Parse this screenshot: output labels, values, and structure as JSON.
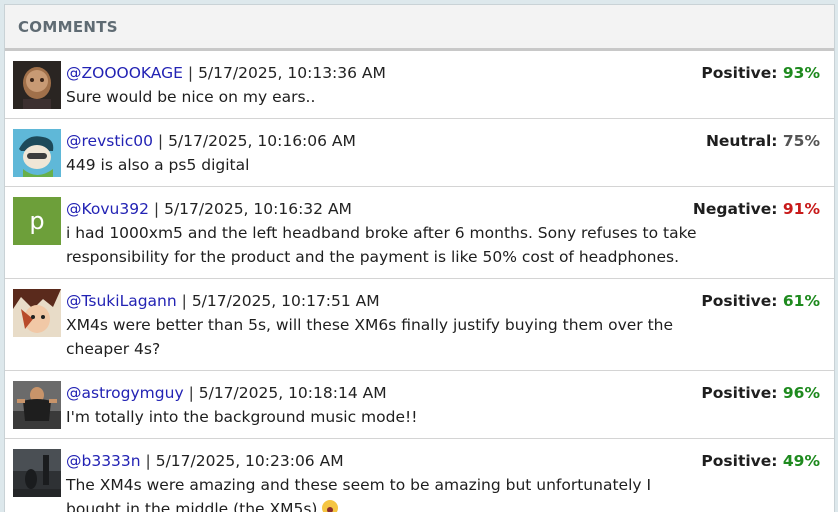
{
  "header": {
    "title": "COMMENTS"
  },
  "colors": {
    "positive": "#1e8a1e",
    "neutral": "#555555",
    "negative": "#c81a1a",
    "user": "#2323b4"
  },
  "comments": [
    {
      "user": "@ZOOOOKAGE",
      "separator": "|",
      "timestamp": "5/17/2025, 10:13:36 AM",
      "text": "Sure would be nice on my ears..",
      "sentiment_label": "Positive:",
      "sentiment_score": "93%",
      "sentiment": "positive",
      "avatar": "photo-avatar"
    },
    {
      "user": "@revstic00",
      "separator": "|",
      "timestamp": "5/17/2025, 10:16:06 AM",
      "text": "449 is also a ps5 digital",
      "sentiment_label": "Neutral:",
      "sentiment_score": "75%",
      "sentiment": "neutral",
      "avatar": "cartoon-avatar"
    },
    {
      "user": "@Kovu392",
      "separator": "|",
      "timestamp": "5/17/2025, 10:16:32 AM",
      "text": "i had 1000xm5 and the left headband broke after 6 months. Sony refuses to take responsibility for the product and the payment is like 50% cost of headphones.",
      "sentiment_label": "Negative:",
      "sentiment_score": "91%",
      "sentiment": "negative",
      "avatar_letter": "p"
    },
    {
      "user": "@TsukiLagann",
      "separator": "|",
      "timestamp": "5/17/2025, 10:17:51 AM",
      "text": "XM4s were better than 5s, will these XM6s finally justify buying them over the cheaper 4s?",
      "sentiment_label": "Positive:",
      "sentiment_score": "61%",
      "sentiment": "positive",
      "avatar": "anime-avatar"
    },
    {
      "user": "@astrogymguy",
      "separator": "|",
      "timestamp": "5/17/2025, 10:18:14 AM",
      "text": "I'm totally into the background music mode!!",
      "sentiment_label": "Positive:",
      "sentiment_score": "96%",
      "sentiment": "positive",
      "avatar": "gym-photo-avatar"
    },
    {
      "user": "@b3333n",
      "separator": "|",
      "timestamp": "5/17/2025, 10:23:06 AM",
      "text": "The XM4s were amazing and these seem to be amazing but unfortunately I bought in the middle (the XM5s)",
      "emoji": "crying-face-emoji",
      "sentiment_label": "Positive:",
      "sentiment_score": "49%",
      "sentiment": "positive",
      "avatar": "dark-photo-avatar"
    }
  ]
}
